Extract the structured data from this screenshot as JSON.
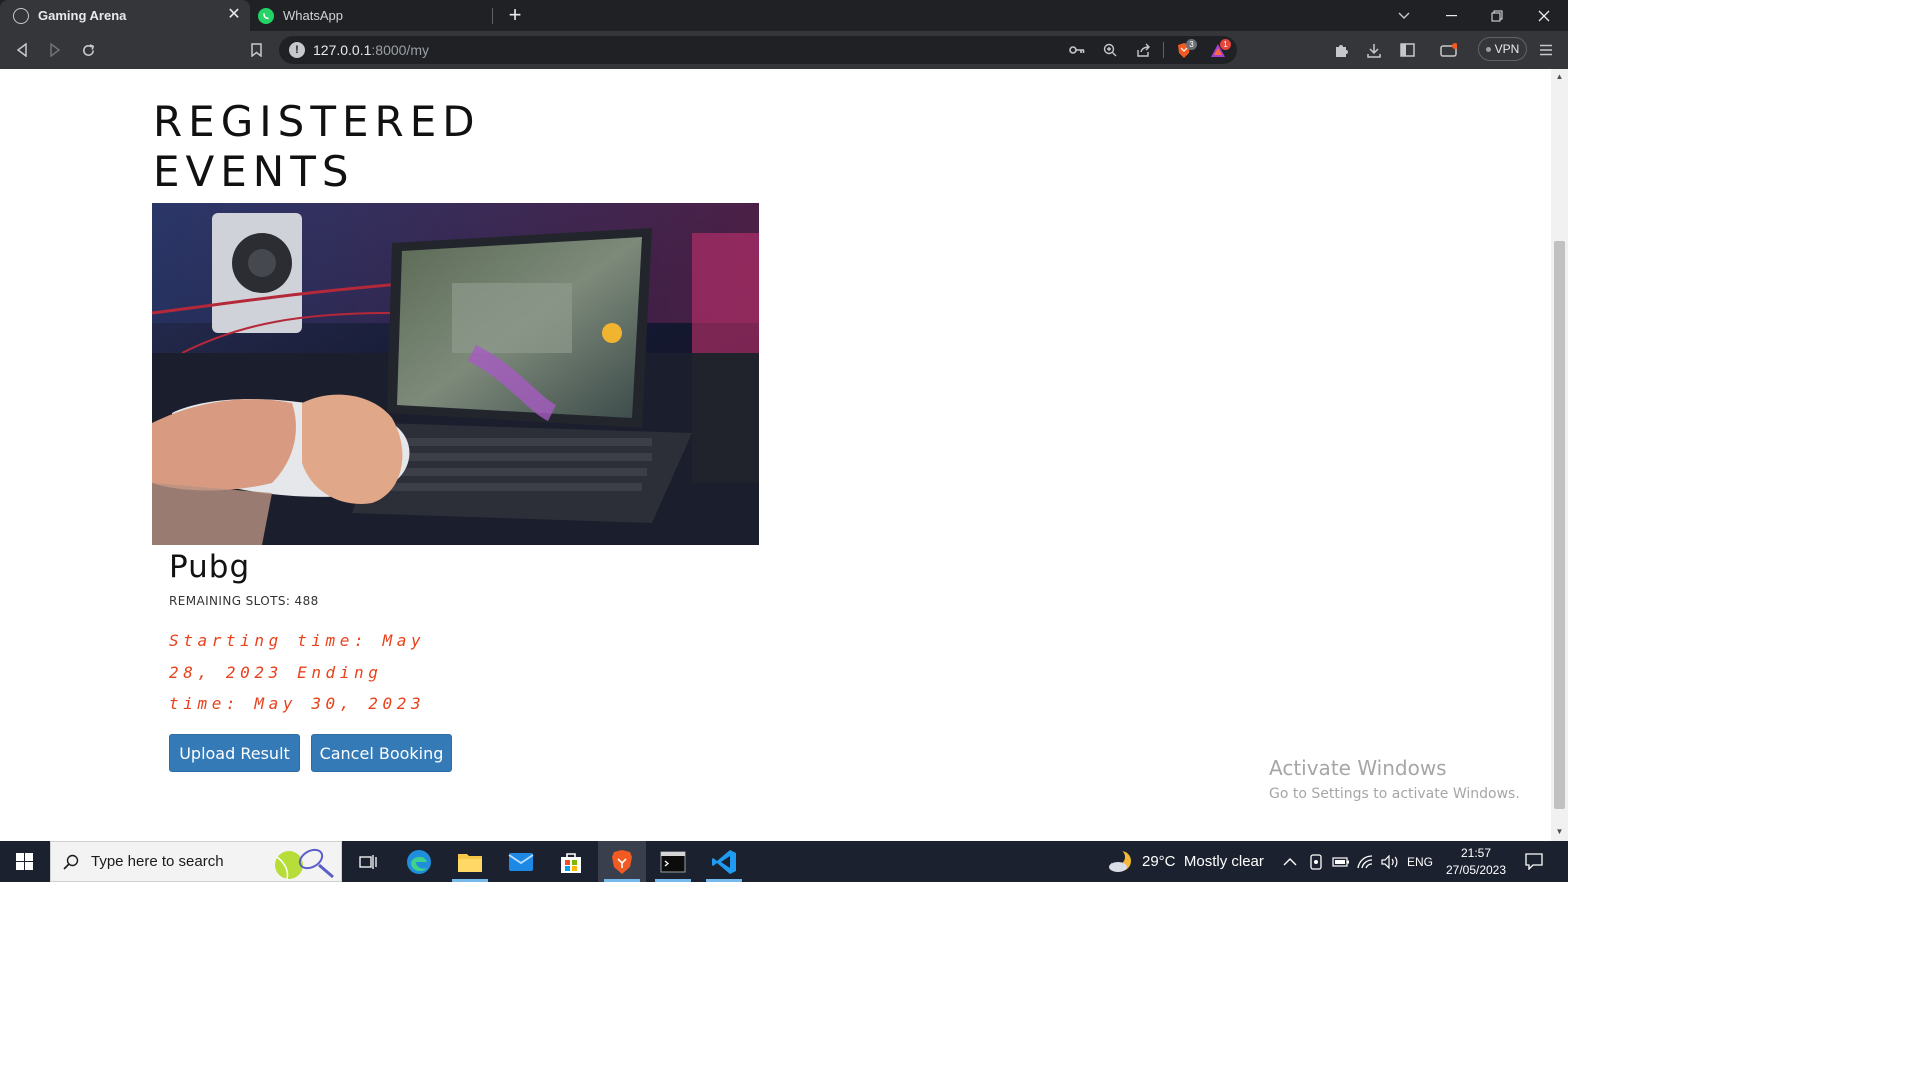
{
  "browser": {
    "tabs": [
      {
        "title": "Gaming Arena",
        "active": true,
        "icon": "globe-icon"
      },
      {
        "title": "WhatsApp",
        "active": false,
        "icon": "whatsapp-icon"
      }
    ],
    "close_tab_symbol": "✕",
    "new_tab_symbol": "+",
    "url_host": "127.0.0.1",
    "url_path": ":8000/my",
    "shields_badge": "3",
    "rewards_badge": "1",
    "vpn_label": "VPN"
  },
  "page": {
    "heading": "REGISTERED EVENTS",
    "event": {
      "title": "Pubg",
      "slots_label": "REMAINING SLOTS: 488",
      "timing": "Starting time: May 28, 2023 Ending time: May 30, 2023",
      "upload_label": "Upload Result",
      "cancel_label": "Cancel Booking"
    },
    "watermark": {
      "title": "Activate Windows",
      "subtitle": "Go to Settings to activate Windows."
    }
  },
  "taskbar": {
    "search_placeholder": "Type here to search",
    "weather": "29°C  Mostly clear",
    "language": "ENG",
    "time": "21:57",
    "date": "27/05/2023"
  },
  "colors": {
    "accent_button": "#337ab7",
    "timing_text": "#e8421c",
    "taskbar": "#1c2130"
  }
}
